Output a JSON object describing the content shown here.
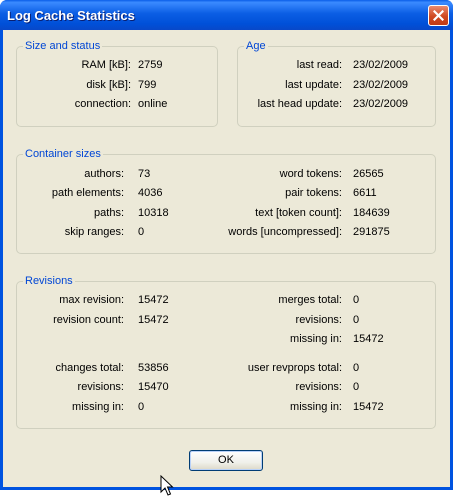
{
  "window": {
    "title": "Log Cache Statistics"
  },
  "size_status": {
    "title": "Size and status",
    "rows": [
      {
        "label": "RAM [kB]:",
        "value": "2759"
      },
      {
        "label": "disk [kB]:",
        "value": "799"
      },
      {
        "label": "connection:",
        "value": "online"
      }
    ]
  },
  "age": {
    "title": "Age",
    "rows": [
      {
        "label": "last read:",
        "value": "23/02/2009"
      },
      {
        "label": "last update:",
        "value": "23/02/2009"
      },
      {
        "label": "last head update:",
        "value": "23/02/2009"
      }
    ]
  },
  "container": {
    "title": "Container sizes",
    "left": [
      {
        "label": "authors:",
        "value": "73"
      },
      {
        "label": "path elements:",
        "value": "4036"
      },
      {
        "label": "paths:",
        "value": "10318"
      },
      {
        "label": "skip ranges:",
        "value": "0"
      }
    ],
    "right": [
      {
        "label": "word tokens:",
        "value": "26565"
      },
      {
        "label": "pair tokens:",
        "value": "6611"
      },
      {
        "label": "text [token count]:",
        "value": "184639"
      },
      {
        "label": "words [uncompressed]:",
        "value": "291875"
      }
    ]
  },
  "revisions": {
    "title": "Revisions",
    "max_revision": {
      "label": "max revision:",
      "value": "15472"
    },
    "revision_count": {
      "label": "revision count:",
      "value": "15472"
    },
    "merges": [
      {
        "label": "merges total:",
        "value": "0"
      },
      {
        "label": "revisions:",
        "value": "0"
      },
      {
        "label": "missing in:",
        "value": "15472"
      }
    ],
    "changes": [
      {
        "label": "changes total:",
        "value": "53856"
      },
      {
        "label": "revisions:",
        "value": "15470"
      },
      {
        "label": "missing in:",
        "value": "0"
      }
    ],
    "user_revprops": [
      {
        "label": "user revprops total:",
        "value": "0"
      },
      {
        "label": "revisions:",
        "value": "0"
      },
      {
        "label": "missing in:",
        "value": "15472"
      }
    ]
  },
  "ok_button": {
    "label": "OK"
  }
}
